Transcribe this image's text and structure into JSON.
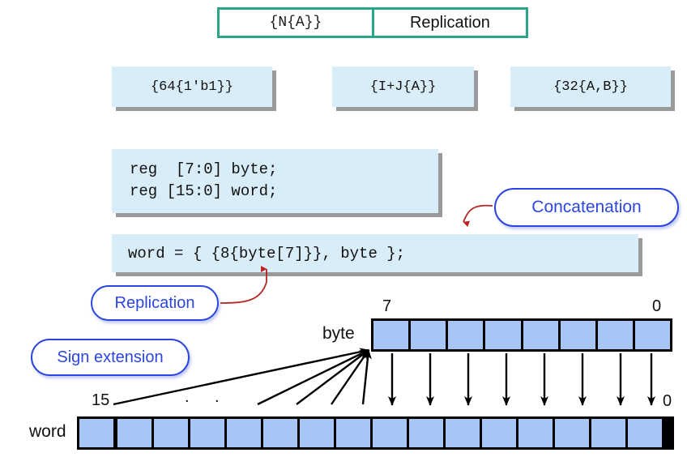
{
  "top_table": {
    "syntax": "{N{A}}",
    "meaning": "Replication",
    "border_color": "#2aa58c"
  },
  "examples": [
    {
      "text": "{64{1'b1}}"
    },
    {
      "text": "{I+J{A}}"
    },
    {
      "text": "{32{A,B}}"
    }
  ],
  "code": {
    "declaration": "reg  [7:0] byte;\nreg [15:0] word;",
    "expression": "word = { {8{byte[7]}}, byte };",
    "box_fill": "#d9edf9"
  },
  "callouts": {
    "concatenation": "Concatenation",
    "replication": "Replication",
    "sign_extension": "Sign extension",
    "color": "#2b46e0",
    "connector_color": "#b02020"
  },
  "diagram": {
    "byte_register": {
      "name": "byte",
      "msb_label": "7",
      "lsb_label": "0",
      "bits": 8,
      "cell_color": "#a8c6f5"
    },
    "word_register": {
      "name": "word",
      "msb_label": "15",
      "lsb_label": "0",
      "bits": 16,
      "cell_color": "#a8c6f5"
    },
    "ellipsis": {
      "dot1": ".",
      "dot2": "."
    }
  }
}
